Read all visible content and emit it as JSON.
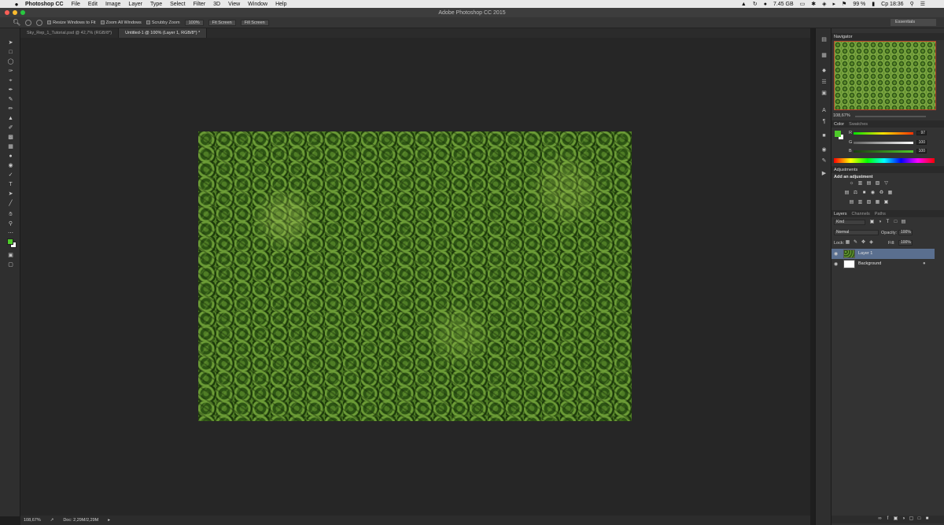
{
  "menubar": {
    "apple": "",
    "app_name": "Photoshop CC",
    "items": [
      "File",
      "Edit",
      "Image",
      "Layer",
      "Type",
      "Select",
      "Filter",
      "3D",
      "View",
      "Window",
      "Help"
    ],
    "memory": "7.45 GB",
    "battery": "99 %",
    "clock": "Ср 18:36"
  },
  "window": {
    "title": "Adobe Photoshop CC 2015"
  },
  "options_bar": {
    "resize_windows": "Resize Windows to Fit",
    "zoom_all_windows": "Zoom All Windows",
    "scrubby_zoom": "Scrubby Zoom",
    "zoom_100": "100%",
    "fit_screen": "Fit Screen",
    "fill_screen": "Fill Screen",
    "workspace": "Essentials"
  },
  "tabs": [
    {
      "label": "Sky_Rep_1_Tutorial.psd @ 42,7% (RGB/8*)"
    },
    {
      "label": "Untitled-1 @ 100% (Layer 1, RGB/8*) *"
    }
  ],
  "status": {
    "zoom": "108,67%",
    "doc": "Doc: 2,29M/2,29M"
  },
  "navigator": {
    "title": "Navigator",
    "zoom": "108,67%"
  },
  "color_panel": {
    "tab_color": "Color",
    "tab_swatches": "Swatches",
    "r_label": "R",
    "r_value": "97",
    "g_label": "G",
    "g_value": "100",
    "b_label": "B",
    "b_value": "100",
    "foreground": "#4ecb2a",
    "background": "#ffffff"
  },
  "adjustments": {
    "title": "Adjustments",
    "subtitle": "Add an adjustment"
  },
  "layers_panel": {
    "tab_layers": "Layers",
    "tab_channels": "Channels",
    "tab_paths": "Paths",
    "kind": "Kind",
    "blend_mode": "Normal",
    "opacity_label": "Opacity:",
    "opacity_value": "100%",
    "lock_label": "Lock:",
    "fill_label": "Fill:",
    "fill_value": "100%",
    "layers": [
      {
        "name": "Layer 1",
        "selected": true
      },
      {
        "name": "Background",
        "selected": false
      }
    ]
  }
}
